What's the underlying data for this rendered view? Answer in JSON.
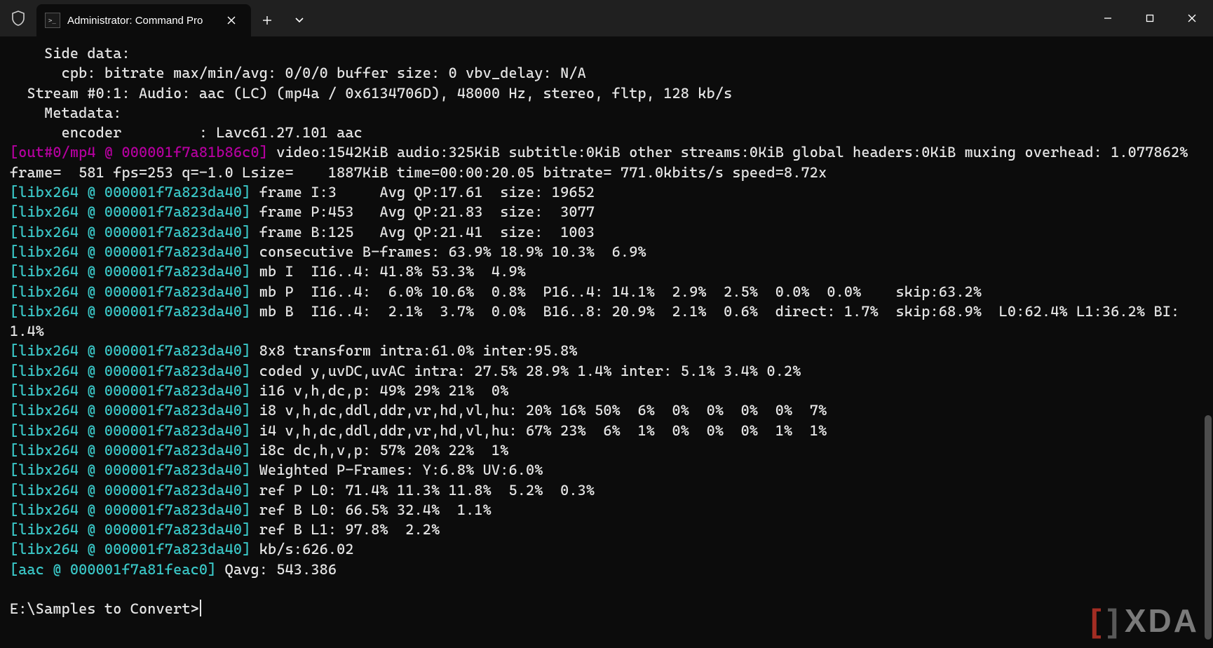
{
  "window": {
    "tab_title": "Administrator: Command Pro"
  },
  "watermark": {
    "bracket_left": "[",
    "bracket_right": "]",
    "text": "XDA"
  },
  "terminal": {
    "prompt": "E:\\Samples to Convert>",
    "lines": [
      {
        "segments": [
          {
            "t": "    Side data:"
          }
        ]
      },
      {
        "segments": [
          {
            "t": "      cpb: bitrate max/min/avg: 0/0/0 buffer size: 0 vbv_delay: N/A"
          }
        ]
      },
      {
        "segments": [
          {
            "t": "  Stream #0:1: Audio: aac (LC) (mp4a / 0x6134706D), 48000 Hz, stereo, fltp, 128 kb/s"
          }
        ]
      },
      {
        "segments": [
          {
            "t": "    Metadata:"
          }
        ]
      },
      {
        "segments": [
          {
            "t": "      encoder         : Lavc61.27.101 aac"
          }
        ]
      },
      {
        "segments": [
          {
            "t": "[out#0/mp4 @ 000001f7a81b86c0]",
            "c": "magenta"
          },
          {
            "t": " video:1542KiB audio:325KiB subtitle:0KiB other streams:0KiB global headers:0KiB muxing overhead: 1.077862%"
          }
        ]
      },
      {
        "segments": [
          {
            "t": "frame=  581 fps=253 q=-1.0 Lsize=    1887KiB time=00:00:20.05 bitrate= 771.0kbits/s speed=8.72x"
          }
        ]
      },
      {
        "segments": [
          {
            "t": "[libx264 @ 000001f7a823da40]",
            "c": "cyan"
          },
          {
            "t": " frame I:3     Avg QP:17.61  size: 19652"
          }
        ]
      },
      {
        "segments": [
          {
            "t": "[libx264 @ 000001f7a823da40]",
            "c": "cyan"
          },
          {
            "t": " frame P:453   Avg QP:21.83  size:  3077"
          }
        ]
      },
      {
        "segments": [
          {
            "t": "[libx264 @ 000001f7a823da40]",
            "c": "cyan"
          },
          {
            "t": " frame B:125   Avg QP:21.41  size:  1003"
          }
        ]
      },
      {
        "segments": [
          {
            "t": "[libx264 @ 000001f7a823da40]",
            "c": "cyan"
          },
          {
            "t": " consecutive B-frames: 63.9% 18.9% 10.3%  6.9%"
          }
        ]
      },
      {
        "segments": [
          {
            "t": "[libx264 @ 000001f7a823da40]",
            "c": "cyan"
          },
          {
            "t": " mb I  I16..4: 41.8% 53.3%  4.9%"
          }
        ]
      },
      {
        "segments": [
          {
            "t": "[libx264 @ 000001f7a823da40]",
            "c": "cyan"
          },
          {
            "t": " mb P  I16..4:  6.0% 10.6%  0.8%  P16..4: 14.1%  2.9%  2.5%  0.0%  0.0%    skip:63.2%"
          }
        ]
      },
      {
        "segments": [
          {
            "t": "[libx264 @ 000001f7a823da40]",
            "c": "cyan"
          },
          {
            "t": " mb B  I16..4:  2.1%  3.7%  0.0%  B16..8: 20.9%  2.1%  0.6%  direct: 1.7%  skip:68.9%  L0:62.4% L1:36.2% BI: 1.4%"
          }
        ]
      },
      {
        "segments": [
          {
            "t": "[libx264 @ 000001f7a823da40]",
            "c": "cyan"
          },
          {
            "t": " 8x8 transform intra:61.0% inter:95.8%"
          }
        ]
      },
      {
        "segments": [
          {
            "t": "[libx264 @ 000001f7a823da40]",
            "c": "cyan"
          },
          {
            "t": " coded y,uvDC,uvAC intra: 27.5% 28.9% 1.4% inter: 5.1% 3.4% 0.2%"
          }
        ]
      },
      {
        "segments": [
          {
            "t": "[libx264 @ 000001f7a823da40]",
            "c": "cyan"
          },
          {
            "t": " i16 v,h,dc,p: 49% 29% 21%  0%"
          }
        ]
      },
      {
        "segments": [
          {
            "t": "[libx264 @ 000001f7a823da40]",
            "c": "cyan"
          },
          {
            "t": " i8 v,h,dc,ddl,ddr,vr,hd,vl,hu: 20% 16% 50%  6%  0%  0%  0%  0%  7%"
          }
        ]
      },
      {
        "segments": [
          {
            "t": "[libx264 @ 000001f7a823da40]",
            "c": "cyan"
          },
          {
            "t": " i4 v,h,dc,ddl,ddr,vr,hd,vl,hu: 67% 23%  6%  1%  0%  0%  0%  1%  1%"
          }
        ]
      },
      {
        "segments": [
          {
            "t": "[libx264 @ 000001f7a823da40]",
            "c": "cyan"
          },
          {
            "t": " i8c dc,h,v,p: 57% 20% 22%  1%"
          }
        ]
      },
      {
        "segments": [
          {
            "t": "[libx264 @ 000001f7a823da40]",
            "c": "cyan"
          },
          {
            "t": " Weighted P-Frames: Y:6.8% UV:6.0%"
          }
        ]
      },
      {
        "segments": [
          {
            "t": "[libx264 @ 000001f7a823da40]",
            "c": "cyan"
          },
          {
            "t": " ref P L0: 71.4% 11.3% 11.8%  5.2%  0.3%"
          }
        ]
      },
      {
        "segments": [
          {
            "t": "[libx264 @ 000001f7a823da40]",
            "c": "cyan"
          },
          {
            "t": " ref B L0: 66.5% 32.4%  1.1%"
          }
        ]
      },
      {
        "segments": [
          {
            "t": "[libx264 @ 000001f7a823da40]",
            "c": "cyan"
          },
          {
            "t": " ref B L1: 97.8%  2.2%"
          }
        ]
      },
      {
        "segments": [
          {
            "t": "[libx264 @ 000001f7a823da40]",
            "c": "cyan"
          },
          {
            "t": " kb/s:626.02"
          }
        ]
      },
      {
        "segments": [
          {
            "t": "[aac @ 000001f7a81feac0]",
            "c": "cyan"
          },
          {
            "t": " Qavg: 543.386"
          }
        ]
      }
    ]
  }
}
